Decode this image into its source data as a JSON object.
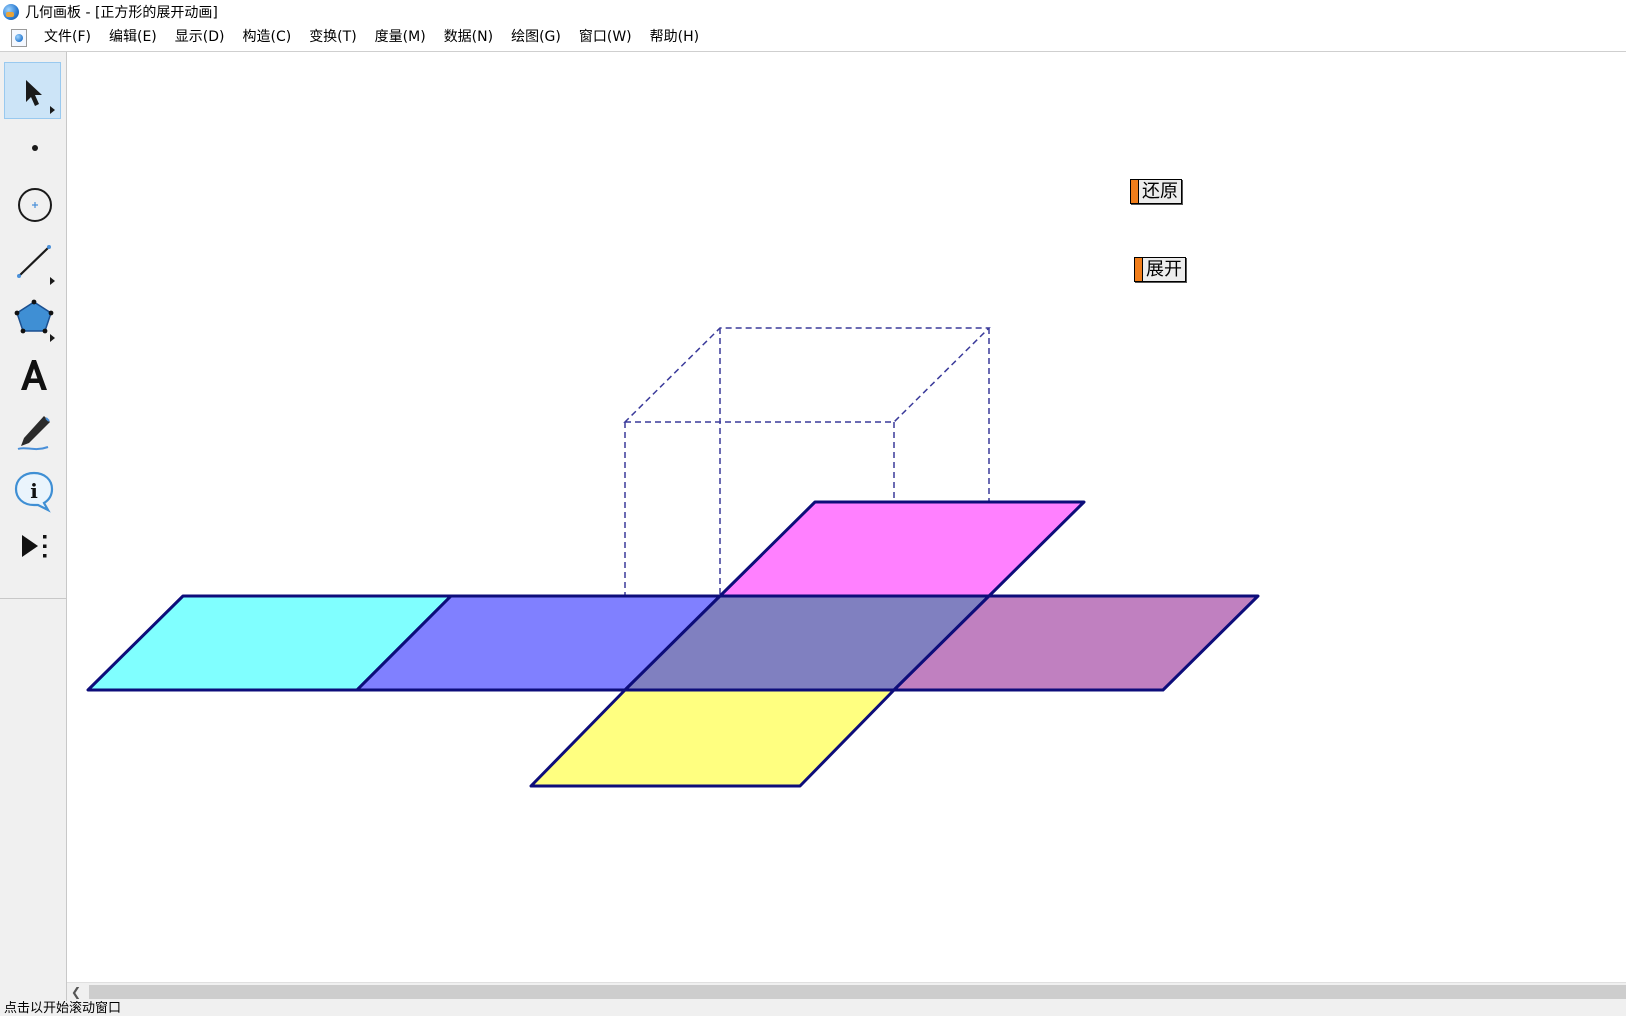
{
  "window": {
    "title": "几何画板 - [正方形的展开动画]"
  },
  "menu": [
    "文件(F)",
    "编辑(E)",
    "显示(D)",
    "构造(C)",
    "变换(T)",
    "度量(M)",
    "数据(N)",
    "绘图(G)",
    "窗口(W)",
    "帮助(H)"
  ],
  "toolbox": {
    "tools": [
      {
        "name": "arrow-tool-icon",
        "selected": true
      },
      {
        "name": "point-tool-icon",
        "selected": false
      },
      {
        "name": "compass-tool-icon",
        "selected": false
      },
      {
        "name": "straightedge-tool-icon",
        "selected": false
      },
      {
        "name": "polygon-tool-icon",
        "selected": false
      },
      {
        "name": "text-tool-icon",
        "selected": false
      },
      {
        "name": "marker-tool-icon",
        "selected": false
      },
      {
        "name": "information-tool-icon",
        "selected": false
      },
      {
        "name": "custom-tool-icon",
        "selected": false
      }
    ]
  },
  "buttons": {
    "restore_label": "还原",
    "unfold_label": "展开"
  },
  "colors": {
    "outline": "#0d0d7a",
    "face_left": "#80ffff",
    "face_left_center": "#8080ff",
    "face_center": "#8080c0",
    "face_right": "#c080c0",
    "face_top": "#ff80ff",
    "face_bottom": "#ffff80",
    "dashed_edges": "#3a3a9a",
    "button_accent": "#f07d1a"
  },
  "status": {
    "text": "点击以开始滚动窗口"
  }
}
